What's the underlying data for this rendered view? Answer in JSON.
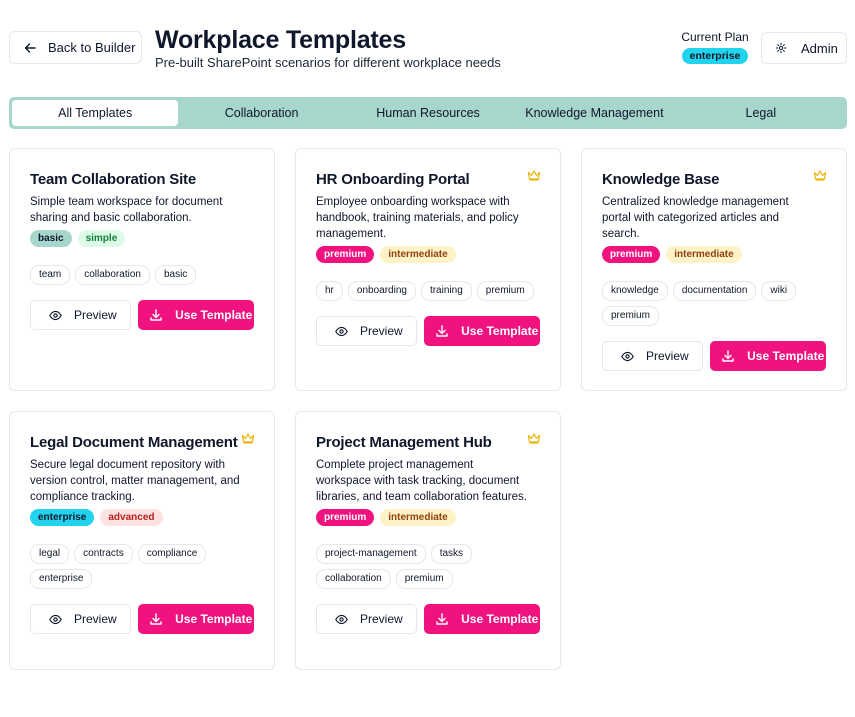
{
  "header": {
    "back_label": "Back to Builder",
    "title": "Workplace Templates",
    "subtitle": "Pre-built SharePoint scenarios for different workplace needs",
    "plan_label": "Current Plan",
    "plan_value": "enterprise",
    "admin_label": "Admin"
  },
  "tabs": [
    {
      "label": "All Templates",
      "active": true
    },
    {
      "label": "Collaboration",
      "active": false
    },
    {
      "label": "Human Resources",
      "active": false
    },
    {
      "label": "Knowledge Management",
      "active": false
    },
    {
      "label": "Legal",
      "active": false
    }
  ],
  "buttons": {
    "preview": "Preview",
    "use": "Use Template"
  },
  "colors": {
    "accent": "#f0127e",
    "tabs_bg": "#a7d6cc",
    "enterprise": "#22d3ee",
    "crown": "#eab308"
  },
  "templates": [
    {
      "title": "Team Collaboration Site",
      "premium": false,
      "desc": "Simple team workspace for document sharing and basic collaboration.",
      "badges": [
        {
          "label": "basic",
          "bg": "#a7d6cc",
          "fg": "#0f172a"
        },
        {
          "label": "simple",
          "bg": "#dcfce7",
          "fg": "#15803d"
        }
      ],
      "tags": [
        "team",
        "collaboration",
        "basic"
      ]
    },
    {
      "title": "HR Onboarding Portal",
      "premium": true,
      "desc": "Employee onboarding workspace with handbook, training materials, and policy management.",
      "badges": [
        {
          "label": "premium",
          "bg": "#f0127e",
          "fg": "#ffffff"
        },
        {
          "label": "intermediate",
          "bg": "#fef3c7",
          "fg": "#92400e"
        }
      ],
      "tags": [
        "hr",
        "onboarding",
        "training",
        "premium"
      ]
    },
    {
      "title": "Knowledge Base",
      "premium": true,
      "desc": "Centralized knowledge management portal with categorized articles and search.",
      "badges": [
        {
          "label": "premium",
          "bg": "#f0127e",
          "fg": "#ffffff"
        },
        {
          "label": "intermediate",
          "bg": "#fef3c7",
          "fg": "#92400e"
        }
      ],
      "tags": [
        "knowledge",
        "documentation",
        "wiki",
        "premium"
      ]
    },
    {
      "title": "Legal Document Management",
      "premium": true,
      "desc": "Secure legal document repository with version control, matter management, and compliance tracking.",
      "badges": [
        {
          "label": "enterprise",
          "bg": "#22d3ee",
          "fg": "#0f172a"
        },
        {
          "label": "advanced",
          "bg": "#fee2e2",
          "fg": "#b91c1c"
        }
      ],
      "tags": [
        "legal",
        "contracts",
        "compliance",
        "enterprise"
      ]
    },
    {
      "title": "Project Management Hub",
      "premium": true,
      "desc": "Complete project management workspace with task tracking, document libraries, and team collaboration features.",
      "badges": [
        {
          "label": "premium",
          "bg": "#f0127e",
          "fg": "#ffffff"
        },
        {
          "label": "intermediate",
          "bg": "#fef3c7",
          "fg": "#92400e"
        }
      ],
      "tags": [
        "project-management",
        "tasks",
        "collaboration",
        "premium"
      ]
    }
  ]
}
